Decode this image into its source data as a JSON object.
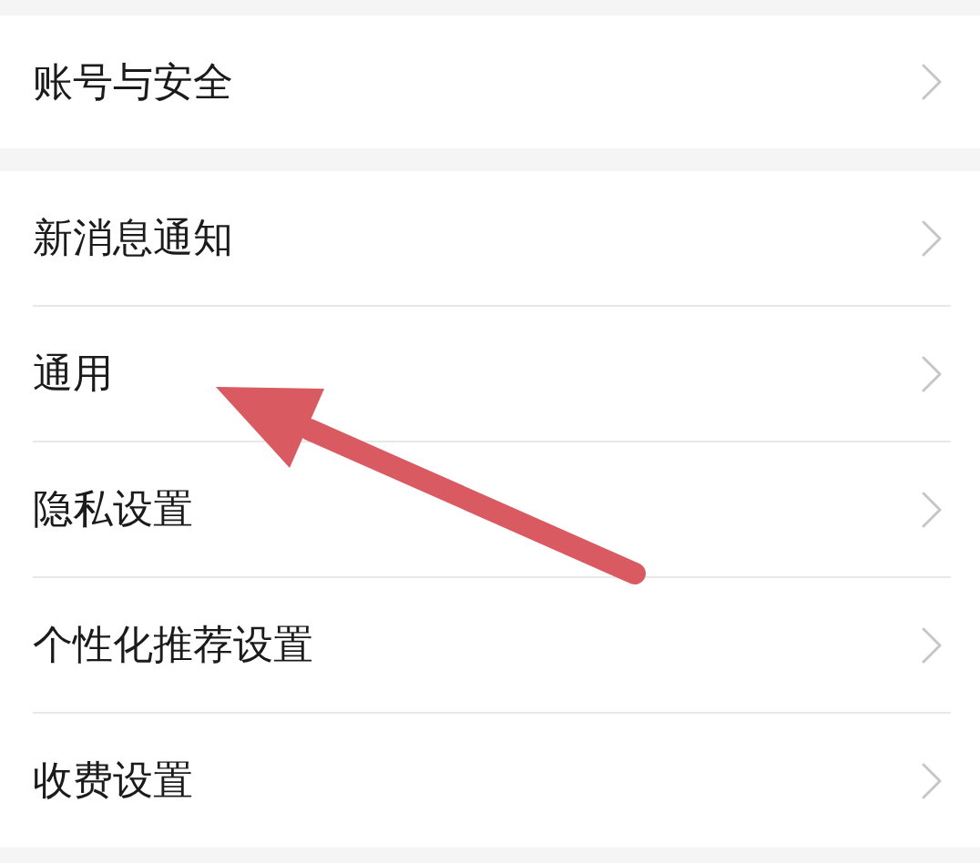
{
  "sections": [
    {
      "items": [
        {
          "label": "账号与安全"
        }
      ]
    },
    {
      "items": [
        {
          "label": "新消息通知"
        },
        {
          "label": "通用"
        },
        {
          "label": "隐私设置"
        },
        {
          "label": "个性化推荐设置"
        },
        {
          "label": "收费设置"
        }
      ]
    }
  ]
}
